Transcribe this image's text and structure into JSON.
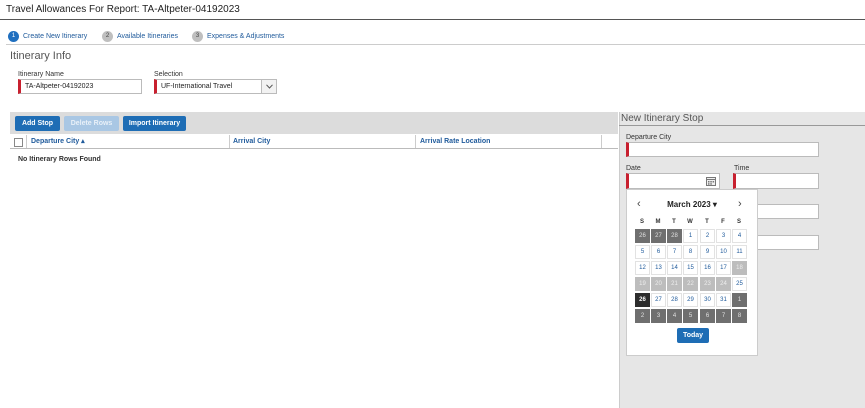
{
  "header": {
    "title": "Travel Allowances For Report: TA-Altpeter-04192023"
  },
  "steps": [
    {
      "num": "1",
      "label": "Create New Itinerary"
    },
    {
      "num": "2",
      "label": "Available Itineraries"
    },
    {
      "num": "3",
      "label": "Expenses & Adjustments"
    }
  ],
  "itinerary_info": {
    "title": "Itinerary Info",
    "name_label": "Itinerary Name",
    "name_value": "TA-Altpeter-04192023",
    "selection_label": "Selection",
    "selection_value": "UF-International Travel"
  },
  "toolbar": {
    "add_stop": "Add Stop",
    "delete_rows": "Delete Rows",
    "import_itinerary": "Import Itinerary"
  },
  "grid": {
    "columns": [
      "Departure City ▴",
      "Arrival City",
      "Arrival Rate Location"
    ],
    "empty_message": "No Itinerary Rows Found"
  },
  "new_stop": {
    "title": "New Itinerary Stop",
    "departure_city_label": "Departure City",
    "date_label": "Date",
    "time_label": "Time"
  },
  "calendar": {
    "month_label": "March 2023 ▾",
    "prev": "‹",
    "next": "›",
    "weekdays": [
      "S",
      "M",
      "T",
      "W",
      "T",
      "F",
      "S"
    ],
    "today_label": "Today",
    "weeks": [
      [
        {
          "d": "26",
          "s": "out"
        },
        {
          "d": "27",
          "s": "out"
        },
        {
          "d": "28",
          "s": "out"
        },
        {
          "d": "1",
          "s": "in"
        },
        {
          "d": "2",
          "s": "in"
        },
        {
          "d": "3",
          "s": "in"
        },
        {
          "d": "4",
          "s": "in"
        }
      ],
      [
        {
          "d": "5",
          "s": "in"
        },
        {
          "d": "6",
          "s": "in"
        },
        {
          "d": "7",
          "s": "in"
        },
        {
          "d": "8",
          "s": "in"
        },
        {
          "d": "9",
          "s": "in"
        },
        {
          "d": "10",
          "s": "in"
        },
        {
          "d": "11",
          "s": "in"
        }
      ],
      [
        {
          "d": "12",
          "s": "in"
        },
        {
          "d": "13",
          "s": "in"
        },
        {
          "d": "14",
          "s": "in"
        },
        {
          "d": "15",
          "s": "in"
        },
        {
          "d": "16",
          "s": "in"
        },
        {
          "d": "17",
          "s": "in"
        },
        {
          "d": "18",
          "s": "dis"
        }
      ],
      [
        {
          "d": "19",
          "s": "dis"
        },
        {
          "d": "20",
          "s": "dis"
        },
        {
          "d": "21",
          "s": "dis"
        },
        {
          "d": "22",
          "s": "dis"
        },
        {
          "d": "23",
          "s": "dis"
        },
        {
          "d": "24",
          "s": "dis"
        },
        {
          "d": "25",
          "s": "in"
        }
      ],
      [
        {
          "d": "26",
          "s": "sel"
        },
        {
          "d": "27",
          "s": "in"
        },
        {
          "d": "28",
          "s": "in"
        },
        {
          "d": "29",
          "s": "in"
        },
        {
          "d": "30",
          "s": "in"
        },
        {
          "d": "31",
          "s": "in"
        },
        {
          "d": "1",
          "s": "out"
        }
      ],
      [
        {
          "d": "2",
          "s": "out"
        },
        {
          "d": "3",
          "s": "out"
        },
        {
          "d": "4",
          "s": "out"
        },
        {
          "d": "5",
          "s": "out"
        },
        {
          "d": "6",
          "s": "out"
        },
        {
          "d": "7",
          "s": "out"
        },
        {
          "d": "8",
          "s": "out"
        }
      ]
    ]
  }
}
